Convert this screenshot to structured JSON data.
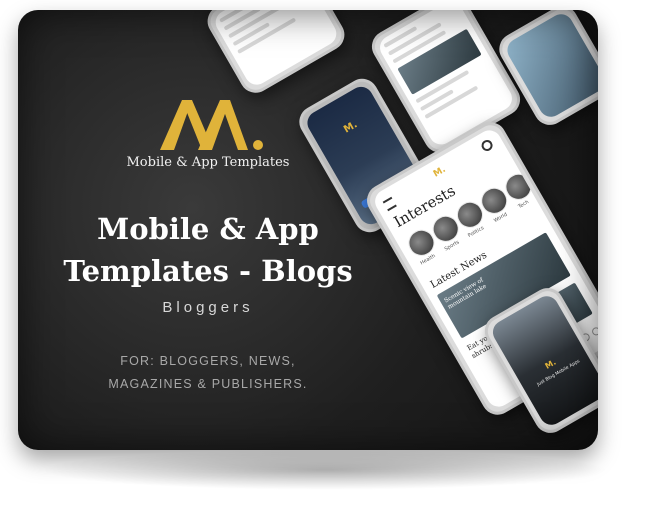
{
  "brand": {
    "name": "Mobile & App Templates"
  },
  "hero": {
    "title_line1": "Mobile & App",
    "title_line2": "Templates - Blogs",
    "subtitle": "Bloggers",
    "for_line1": "FOR: BLOGGERS, NEWS,",
    "for_line2": "MAGAZINES & PUBLISHERS."
  },
  "mockup": {
    "interests_title": "Interests",
    "categories": [
      "Health",
      "Sports",
      "Politics",
      "World",
      "Tech"
    ],
    "latest_news": "Latest News",
    "article_headline": "Scenic view of mountain lake",
    "article_text": "Eat your mulch like, shrubs to size on...",
    "small_screen_title": "Just Blog Mobile Apps"
  },
  "colors": {
    "accent": "#e0b33a",
    "background": "#1c1c1c",
    "text": "#ffffff"
  },
  "icons": [
    "logo-mark-icon",
    "menu-icon",
    "search-icon",
    "heart-icon",
    "share-icon"
  ]
}
